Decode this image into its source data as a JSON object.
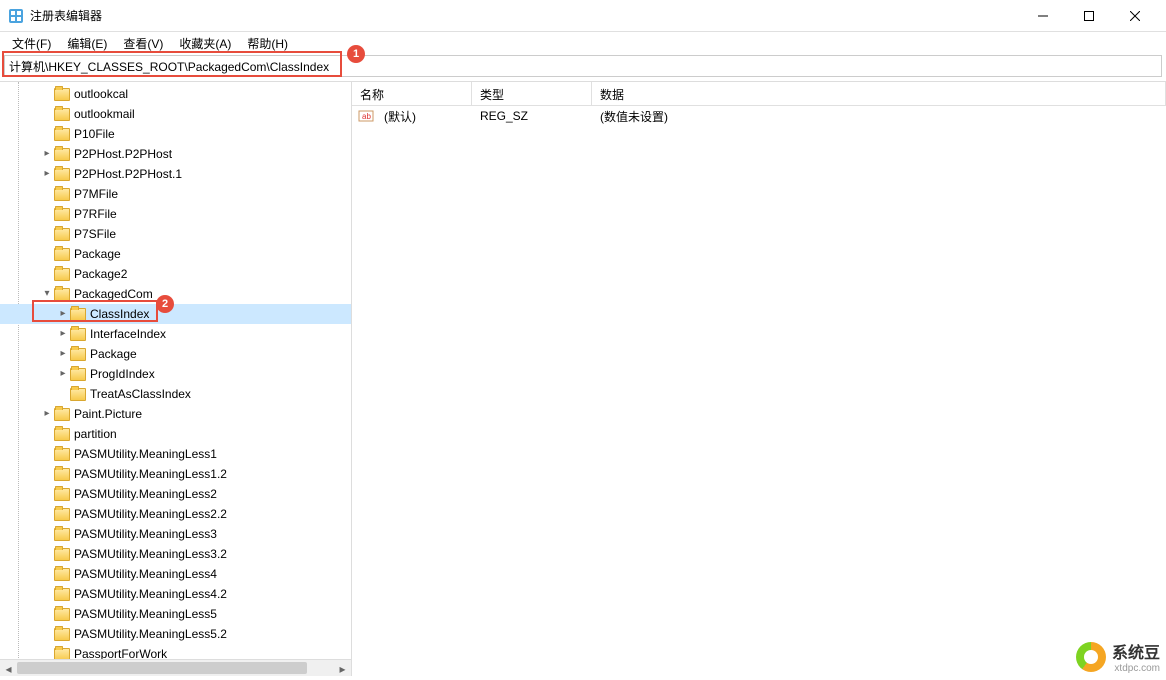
{
  "window": {
    "title": "注册表编辑器"
  },
  "menu": {
    "file": "文件(F)",
    "edit": "编辑(E)",
    "view": "查看(V)",
    "favorites": "收藏夹(A)",
    "help": "帮助(H)"
  },
  "address": "计算机\\HKEY_CLASSES_ROOT\\PackagedCom\\ClassIndex",
  "callouts": {
    "one": "1",
    "two": "2"
  },
  "tree": [
    {
      "label": "outlookcal",
      "indent": 2,
      "exp": "",
      "selected": false
    },
    {
      "label": "outlookmail",
      "indent": 2,
      "exp": "",
      "selected": false
    },
    {
      "label": "P10File",
      "indent": 2,
      "exp": "",
      "selected": false
    },
    {
      "label": "P2PHost.P2PHost",
      "indent": 2,
      "exp": ">",
      "selected": false
    },
    {
      "label": "P2PHost.P2PHost.1",
      "indent": 2,
      "exp": ">",
      "selected": false
    },
    {
      "label": "P7MFile",
      "indent": 2,
      "exp": "",
      "selected": false
    },
    {
      "label": "P7RFile",
      "indent": 2,
      "exp": "",
      "selected": false
    },
    {
      "label": "P7SFile",
      "indent": 2,
      "exp": "",
      "selected": false
    },
    {
      "label": "Package",
      "indent": 2,
      "exp": "",
      "selected": false
    },
    {
      "label": "Package2",
      "indent": 2,
      "exp": "",
      "selected": false
    },
    {
      "label": "PackagedCom",
      "indent": 2,
      "exp": "v",
      "selected": false
    },
    {
      "label": "ClassIndex",
      "indent": 3,
      "exp": ">",
      "selected": true,
      "red": true
    },
    {
      "label": "InterfaceIndex",
      "indent": 3,
      "exp": ">",
      "selected": false
    },
    {
      "label": "Package",
      "indent": 3,
      "exp": ">",
      "selected": false
    },
    {
      "label": "ProgIdIndex",
      "indent": 3,
      "exp": ">",
      "selected": false
    },
    {
      "label": "TreatAsClassIndex",
      "indent": 3,
      "exp": "",
      "selected": false
    },
    {
      "label": "Paint.Picture",
      "indent": 2,
      "exp": ">",
      "selected": false
    },
    {
      "label": "partition",
      "indent": 2,
      "exp": "",
      "selected": false
    },
    {
      "label": "PASMUtility.MeaningLess1",
      "indent": 2,
      "exp": "",
      "selected": false
    },
    {
      "label": "PASMUtility.MeaningLess1.2",
      "indent": 2,
      "exp": "",
      "selected": false
    },
    {
      "label": "PASMUtility.MeaningLess2",
      "indent": 2,
      "exp": "",
      "selected": false
    },
    {
      "label": "PASMUtility.MeaningLess2.2",
      "indent": 2,
      "exp": "",
      "selected": false
    },
    {
      "label": "PASMUtility.MeaningLess3",
      "indent": 2,
      "exp": "",
      "selected": false
    },
    {
      "label": "PASMUtility.MeaningLess3.2",
      "indent": 2,
      "exp": "",
      "selected": false
    },
    {
      "label": "PASMUtility.MeaningLess4",
      "indent": 2,
      "exp": "",
      "selected": false
    },
    {
      "label": "PASMUtility.MeaningLess4.2",
      "indent": 2,
      "exp": "",
      "selected": false
    },
    {
      "label": "PASMUtility.MeaningLess5",
      "indent": 2,
      "exp": "",
      "selected": false
    },
    {
      "label": "PASMUtility.MeaningLess5.2",
      "indent": 2,
      "exp": "",
      "selected": false
    },
    {
      "label": "PassportForWork",
      "indent": 2,
      "exp": "",
      "selected": false
    }
  ],
  "list": {
    "headers": {
      "name": "名称",
      "type": "类型",
      "data": "数据"
    },
    "rows": [
      {
        "name": "(默认)",
        "type": "REG_SZ",
        "data": "(数值未设置)"
      }
    ]
  },
  "watermark": {
    "title": "系统豆",
    "url": "xtdpc.com"
  }
}
